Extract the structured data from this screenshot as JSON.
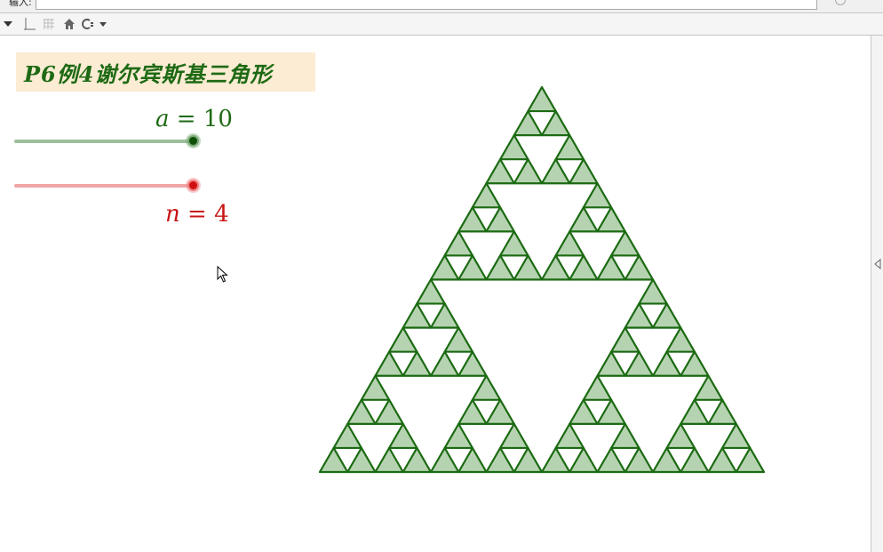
{
  "input_bar": {
    "label": "输入:",
    "value": ""
  },
  "toolbar": {
    "icons": [
      "graphics-view-icon",
      "grid-icon",
      "home-icon",
      "style-icon",
      "dropdown-icon"
    ]
  },
  "graphics": {
    "title": "P6例4谢尔宾斯基三角形",
    "slider_a": {
      "var": "a",
      "equals": " = ",
      "value": "10",
      "color": "#1e6a14"
    },
    "slider_n": {
      "var": "n",
      "equals": " = ",
      "value": "4",
      "color": "#c81414"
    },
    "fractal": {
      "type": "sierpinski-triangle",
      "side_length_a": 10,
      "iterations_n": 4,
      "fill_color": "#b6d3b1",
      "stroke_color": "#1b6a12"
    }
  },
  "colors": {
    "title_bg": "#fbecd3",
    "title_text": "#1e6a14",
    "slider_a_track": "#9dbf99",
    "slider_n_track": "#f0a5a5"
  }
}
